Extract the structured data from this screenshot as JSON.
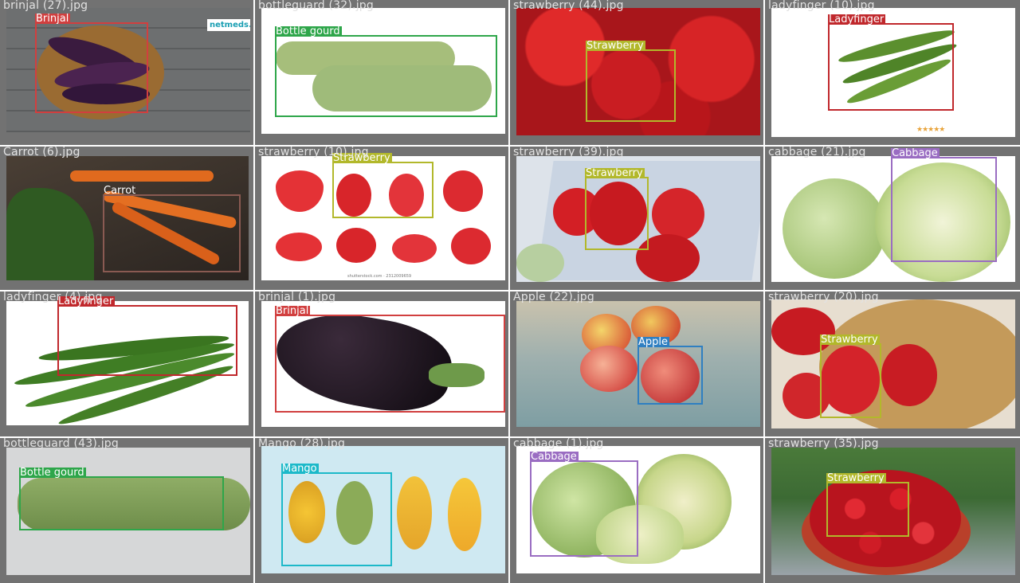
{
  "colors": {
    "Brinjal": "#d13f3f",
    "Bottle gourd": "#2ea64a",
    "Strawberry": "#b2b82b",
    "Ladyfinger": "#c0282c",
    "Carrot": "#8a5a52",
    "Cabbage": "#9a6dc2",
    "Apple": "#2f7fc1",
    "Mango": "#1cb9c9"
  },
  "tiles": [
    {
      "file": "brinjal (27).jpg",
      "label": "Brinjal",
      "watermark": "netmeds.com"
    },
    {
      "file": "bottleguard (32).jpg",
      "label": "Bottle gourd"
    },
    {
      "file": "strawberry (44).jpg",
      "label": "Strawberry"
    },
    {
      "file": "ladyfinger (10).jpg",
      "label": "Ladyfinger",
      "rating": "★★★★★"
    },
    {
      "file": "Carrot (6).jpg",
      "label": "Carrot"
    },
    {
      "file": "strawberry (10).jpg",
      "label": "Strawberry",
      "watermark": "shutterstock.com · 2312009659"
    },
    {
      "file": "strawberry (39).jpg",
      "label": "Strawberry"
    },
    {
      "file": "cabbage (21).jpg",
      "label": "Cabbage"
    },
    {
      "file": "ladyfinger (4).jpg",
      "label": "Ladyfinger"
    },
    {
      "file": "brinjal (1).jpg",
      "label": "Brinjal"
    },
    {
      "file": "Apple (22).jpg",
      "label": "Apple"
    },
    {
      "file": "strawberry (20).jpg",
      "label": "Strawberry"
    },
    {
      "file": "bottleguard (43).jpg",
      "label": "Bottle gourd"
    },
    {
      "file": "Mango (28).jpg",
      "label": "Mango"
    },
    {
      "file": "cabbage (1).jpg",
      "label": "Cabbage"
    },
    {
      "file": "strawberry (35).jpg",
      "label": "Strawberry"
    }
  ]
}
